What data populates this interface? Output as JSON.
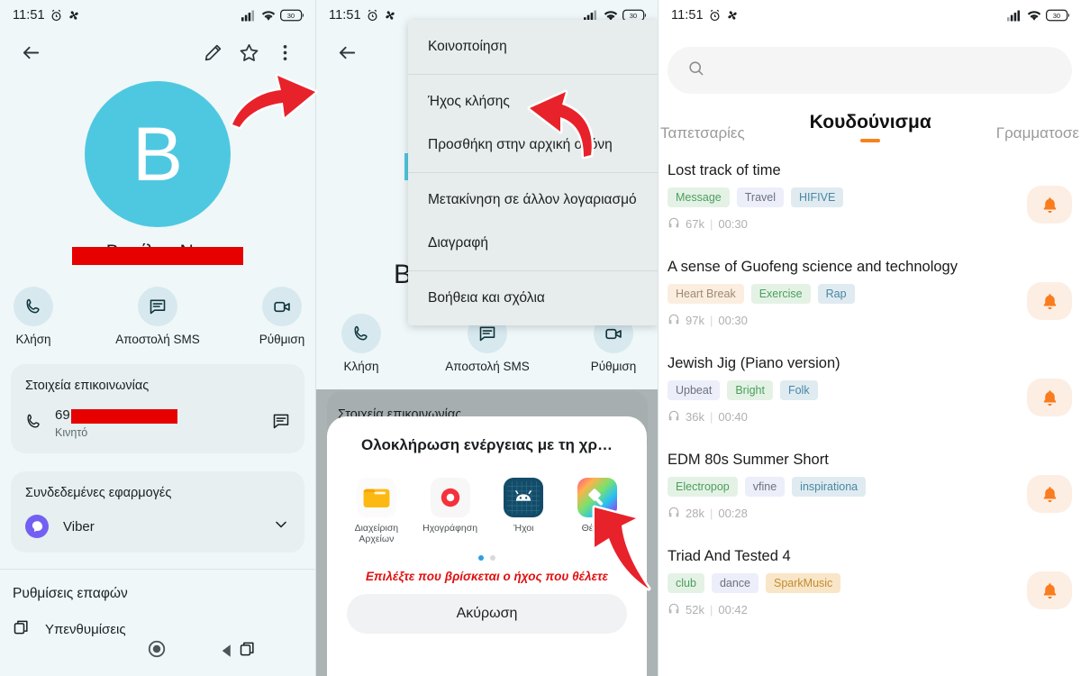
{
  "status_bar": {
    "time": "11:51",
    "battery": "30",
    "icons": [
      "alarm-icon",
      "fan-icon",
      "signal-icon",
      "wifi-icon",
      "battery-icon"
    ]
  },
  "panel1": {
    "toolbar": {
      "back": "back-arrow-icon",
      "edit": "pencil-icon",
      "favorite": "star-icon",
      "more": "overflow-menu-icon"
    },
    "avatar_letter": "B",
    "contact_name_redacted": "Βασίλης Ν...",
    "actions": [
      {
        "label": "Κλήση",
        "icon": "phone-icon"
      },
      {
        "label": "Αποστολή SMS",
        "icon": "message-icon"
      },
      {
        "label": "Ρύθμιση",
        "icon": "video-camera-icon"
      }
    ],
    "contact_card": {
      "title": "Στοιχεία επικοινωνίας",
      "phone_prefix": "69",
      "phone_type": "Κινητό"
    },
    "linked_apps_card": {
      "title": "Συνδεδεμένες εφαρμογές",
      "app": "Viber"
    },
    "settings": {
      "title": "Ρυθμίσεις επαφών",
      "first_item": "Υπενθυμίσεις"
    },
    "nav": {
      "recents": "recents-icon",
      "home": "home-icon",
      "back": "back-icon"
    }
  },
  "panel2": {
    "toolbar": {
      "back": "back-arrow-icon"
    },
    "menu_groups": [
      [
        "Κοινοποίηση"
      ],
      [
        "Ήχος κλήσης",
        "Προσθήκη στην αρχική οθόνη"
      ],
      [
        "Μετακίνηση σε άλλον λογαριασμό",
        "Διαγραφή"
      ],
      [
        "Βοήθεια και σχόλια"
      ]
    ],
    "behind_letter": "Β",
    "actions": [
      {
        "label": "Κλήση",
        "icon": "phone-icon"
      },
      {
        "label": "Αποστολή SMS",
        "icon": "message-icon"
      },
      {
        "label": "Ρύθμιση",
        "icon": "video-camera-icon"
      }
    ],
    "card_title": "Στοιχεία επικοινωνίας",
    "dialog": {
      "title": "Ολοκλήρωση ενέργειας με τη χρ…",
      "apps": [
        {
          "label": "Διαχείριση Αρχείων",
          "icon": "folder-icon"
        },
        {
          "label": "Ηχογράφηση",
          "icon": "record-icon"
        },
        {
          "label": "Ήχοι",
          "icon": "android-icon"
        },
        {
          "label": "Θέματα",
          "icon": "theme-paint-icon"
        }
      ],
      "page_dots": 2,
      "active_dot": 0,
      "hint": "Επιλέξτε που βρίσκεται ο ήχος που θέλετε",
      "cancel_label": "Ακύρωση"
    }
  },
  "panel3": {
    "search": {
      "placeholder": "",
      "icon": "search-icon"
    },
    "tabs": [
      {
        "label": "Ταπετσαρίες",
        "active": false
      },
      {
        "label": "Κουδούνισμα",
        "active": true
      },
      {
        "label": "Γραμματοσε",
        "active": false
      }
    ],
    "accent_color": "#f6821f",
    "ringtones": [
      {
        "title": "Lost track of time",
        "tags": [
          {
            "text": "Message",
            "style": "green"
          },
          {
            "text": "Travel",
            "style": "lav"
          },
          {
            "text": "HIFIVE",
            "style": "blue"
          }
        ],
        "plays": "67k",
        "duration": "00:30"
      },
      {
        "title": "A sense of Guofeng science and technology",
        "tags": [
          {
            "text": "Heart Break",
            "style": "peach"
          },
          {
            "text": "Exercise",
            "style": "green"
          },
          {
            "text": "Rap",
            "style": "blue"
          }
        ],
        "plays": "97k",
        "duration": "00:30"
      },
      {
        "title": "Jewish Jig (Piano version)",
        "tags": [
          {
            "text": "Upbeat",
            "style": "lav"
          },
          {
            "text": "Bright",
            "style": "green"
          },
          {
            "text": "Folk",
            "style": "blue"
          }
        ],
        "plays": "36k",
        "duration": "00:40"
      },
      {
        "title": "EDM 80s Summer Short",
        "tags": [
          {
            "text": "Electropop",
            "style": "green"
          },
          {
            "text": "vfine",
            "style": "lav"
          },
          {
            "text": "inspirationa",
            "style": "blue"
          }
        ],
        "plays": "28k",
        "duration": "00:28"
      },
      {
        "title": "Triad And Tested 4",
        "tags": [
          {
            "text": "club",
            "style": "green"
          },
          {
            "text": "dance",
            "style": "lav"
          },
          {
            "text": "SparkMusic",
            "style": "orange"
          }
        ],
        "plays": "52k",
        "duration": "00:42"
      }
    ],
    "bell_icon": "bell-icon"
  },
  "annotations": {
    "arrow1": "red-arrow-pointing-to-overflow-menu",
    "arrow2": "red-arrow-pointing-to-ringtone-menu-item",
    "arrow3": "red-arrow-pointing-to-themes-app"
  }
}
